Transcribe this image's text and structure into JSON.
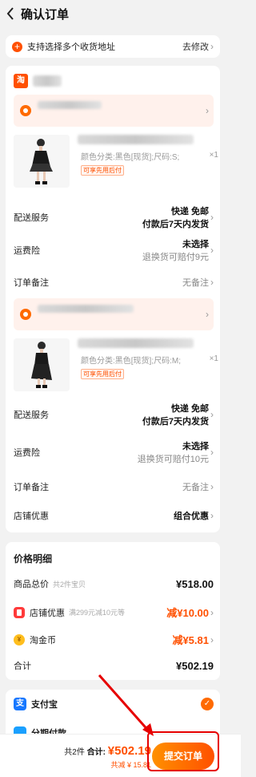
{
  "header": {
    "title": "确认订单"
  },
  "address_tip": {
    "text": "支持选择多个收货地址",
    "edit": "去修改"
  },
  "store": {
    "logo_text": "淘"
  },
  "item1": {
    "spec": "颜色分类:黑色[现货];尺码:S;",
    "qty": "×1",
    "badge": "可享先用后付",
    "delivery_label": "配送服务",
    "delivery_line1": "快递 免邮",
    "delivery_line2": "付款后7天内发货",
    "insurance_label": "运费险",
    "insurance_line1": "未选择",
    "insurance_line2": "退换货可赔付9元",
    "note_label": "订单备注",
    "note_value": "无备注"
  },
  "item2": {
    "spec": "颜色分类:黑色[现货];尺码:M;",
    "qty": "×1",
    "badge": "可享先用后付",
    "delivery_label": "配送服务",
    "delivery_line1": "快递 免邮",
    "delivery_line2": "付款后7天内发货",
    "insurance_label": "运费险",
    "insurance_line1": "未选择",
    "insurance_line2": "退换货可赔付10元",
    "note_label": "订单备注",
    "note_value": "无备注",
    "promo_label": "店铺优惠",
    "promo_value": "组合优惠"
  },
  "price": {
    "title": "价格明细",
    "total_label": "商品总价",
    "total_sub": "共2件宝贝",
    "total_value": "¥518.00",
    "store_disc_label": "店铺优惠",
    "store_disc_sub": "满299元减10元等",
    "store_disc_value": "减¥10.00",
    "coin_label": "淘金币",
    "coin_value": "减¥5.81",
    "sum_label": "合计",
    "sum_value": "¥502.19"
  },
  "payment": {
    "alipay_label": "支付宝",
    "alipay_icon": "支",
    "installment_label": "分期付款"
  },
  "bottom": {
    "count": "共2件",
    "sum_prefix": "合计:",
    "total": "¥502.19",
    "discount": "共减 ¥ 15.81",
    "submit": "提交订单"
  },
  "colors": {
    "accent": "#ff5000",
    "annotation": "#e60000"
  }
}
